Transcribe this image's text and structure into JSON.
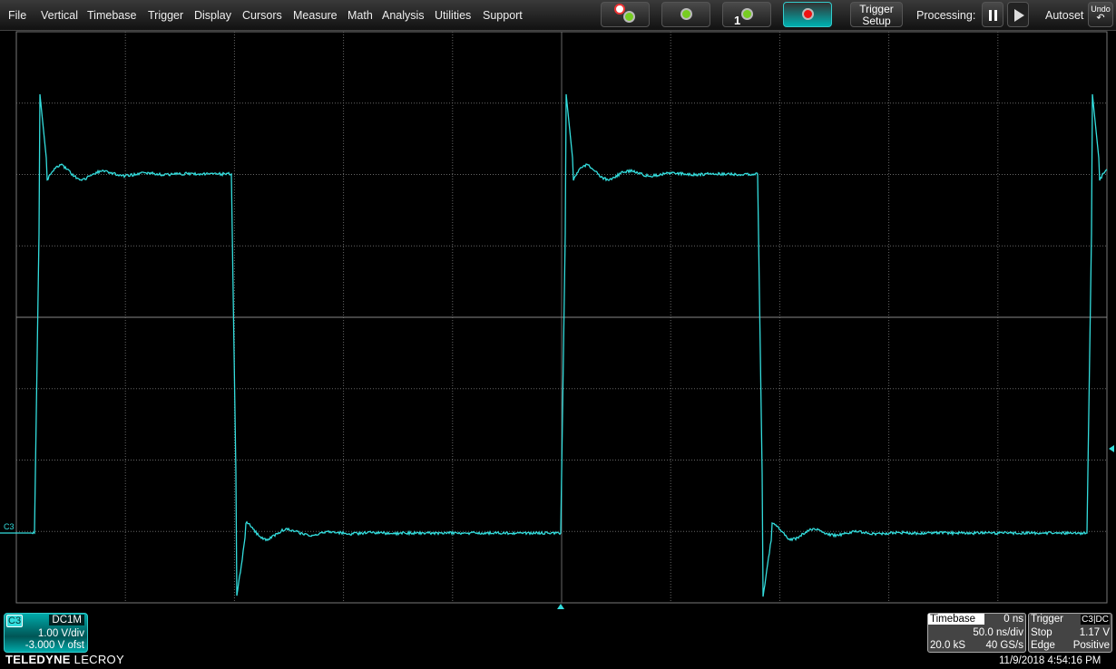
{
  "menu": [
    "File",
    "Vertical",
    "Timebase",
    "Trigger",
    "Display",
    "Cursors",
    "Measure",
    "Math",
    "Analysis",
    "Utilities",
    "Support"
  ],
  "toolbar": {
    "trigger_setup_line1": "Trigger",
    "trigger_setup_line2": "Setup",
    "processing_label": "Processing:",
    "autoset_label": "Autoset",
    "undo_label": "Undo",
    "single_badge": "1"
  },
  "channel": {
    "name": "C3",
    "coupling": "DC1M",
    "vdiv": "1.00 V/div",
    "offset": "-3.000 V ofst",
    "trace_label": "C3",
    "color": "#33dddd"
  },
  "brand": {
    "bold": "TELEDYNE",
    "light": "LECROY"
  },
  "timebase": {
    "label": "Timebase",
    "delay": "0 ns",
    "tdiv": "50.0 ns/div",
    "samples": "20.0 kS",
    "rate": "40 GS/s"
  },
  "trigger": {
    "label": "Trigger",
    "source": "C3",
    "coupling": "DC",
    "mode": "Stop",
    "level": "1.17 V",
    "type": "Edge",
    "slope": "Positive"
  },
  "datetime": "11/9/2018 4:54:16 PM"
}
